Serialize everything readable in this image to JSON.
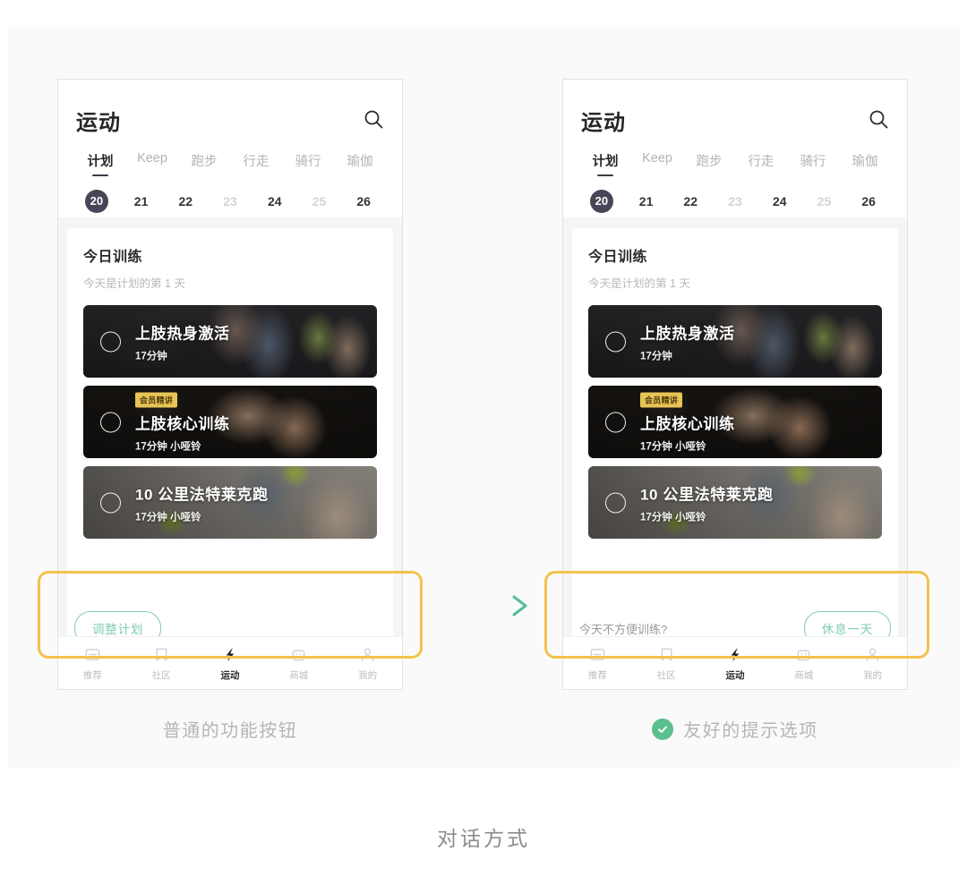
{
  "figure": {
    "title": "对话方式"
  },
  "captions": {
    "left": "普通的功能按钮",
    "right": "友好的提示选项",
    "check_icon": "check-circle-icon"
  },
  "arrow": {
    "icon": "arrow-right-icon",
    "color": "#6ec9a8"
  },
  "highlight": {
    "color": "#f3c24a"
  },
  "app": {
    "title": "运动",
    "search_icon": "search-icon",
    "category_tabs": [
      {
        "label": "计划",
        "active": true
      },
      {
        "label": "Keep",
        "active": false
      },
      {
        "label": "跑步",
        "active": false
      },
      {
        "label": "行走",
        "active": false
      },
      {
        "label": "骑行",
        "active": false
      },
      {
        "label": "瑜伽",
        "active": false
      }
    ],
    "dates": [
      {
        "label": "20",
        "state": "selected"
      },
      {
        "label": "21",
        "state": "normal"
      },
      {
        "label": "22",
        "state": "normal"
      },
      {
        "label": "23",
        "state": "dim"
      },
      {
        "label": "24",
        "state": "normal"
      },
      {
        "label": "25",
        "state": "dim"
      },
      {
        "label": "26",
        "state": "normal"
      }
    ],
    "card": {
      "title": "今日训练",
      "subtitle": "今天是计划的第 1 天"
    },
    "workouts": [
      {
        "name": "上肢热身激活",
        "meta": "17分钟",
        "badge": "",
        "check_icon": "circle-unchecked-icon"
      },
      {
        "name": "上肢核心训练",
        "meta": "17分钟 小哑铃",
        "badge": "会员精讲",
        "check_icon": "circle-unchecked-icon"
      },
      {
        "name": "10 公里法特莱克跑",
        "meta": "17分钟 小哑铃",
        "badge": "",
        "check_icon": "circle-unchecked-icon"
      }
    ],
    "tabbar": [
      {
        "label": "推荐",
        "icon": "card-icon",
        "active": false
      },
      {
        "label": "社区",
        "icon": "bookmark-icon",
        "active": false
      },
      {
        "label": "运动",
        "icon": "lightning-icon",
        "active": true
      },
      {
        "label": "商城",
        "icon": "bag-icon",
        "active": false
      },
      {
        "label": "我的",
        "icon": "person-icon",
        "active": false
      }
    ]
  },
  "variant_left": {
    "hint": "",
    "button": "调整计划"
  },
  "variant_right": {
    "hint": "今天不方便训练?",
    "button": "休息一天"
  }
}
